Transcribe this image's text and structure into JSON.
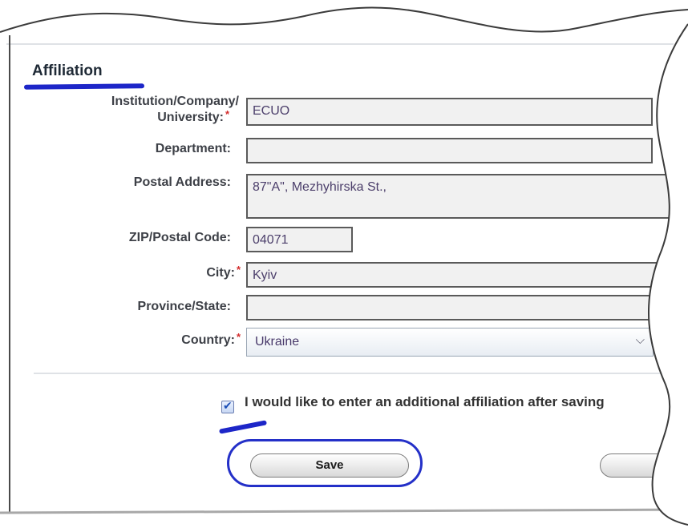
{
  "section": {
    "title": "Affiliation"
  },
  "fields": [
    {
      "key": "institution",
      "label_line1": "Institution/Company/",
      "label_line2": "University:",
      "required": "*",
      "value": "ECUO"
    },
    {
      "key": "department",
      "label": "Department:",
      "value": ""
    },
    {
      "key": "postal_address",
      "label": "Postal Address:",
      "value": "87\"A\", Mezhyhirska St.,"
    },
    {
      "key": "zip",
      "label": "ZIP/Postal Code:",
      "value": "04071"
    },
    {
      "key": "city",
      "label": "City:",
      "required": "*",
      "value": "Kyiv"
    },
    {
      "key": "province",
      "label": "Province/State:",
      "value": ""
    },
    {
      "key": "country",
      "label": "Country:",
      "required": "*",
      "value": "Ukraine"
    }
  ],
  "additional_affiliation": {
    "checked": true,
    "label": "I would like to enter an additional affiliation after saving"
  },
  "buttons": {
    "save": "Save",
    "next": ""
  },
  "colors": {
    "annotation_blue": "#1d26c8",
    "required_red": "#d32b2b",
    "field_text": "#4c3f6b"
  }
}
